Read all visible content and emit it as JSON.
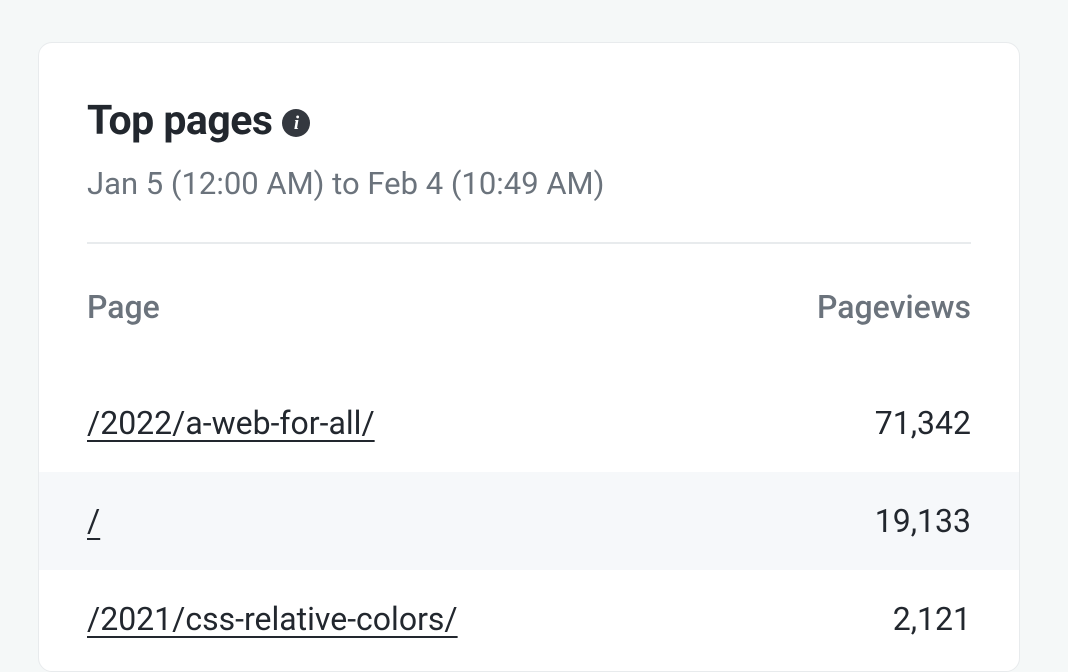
{
  "header": {
    "title": "Top pages",
    "date_range": "Jan 5 (12:00 AM) to Feb 4 (10:49 AM)"
  },
  "columns": {
    "page": "Page",
    "pageviews": "Pageviews"
  },
  "rows": [
    {
      "page": "/2022/a-web-for-all/",
      "views": "71,342"
    },
    {
      "page": "/",
      "views": "19,133"
    },
    {
      "page": "/2021/css-relative-colors/",
      "views": "2,121"
    }
  ]
}
